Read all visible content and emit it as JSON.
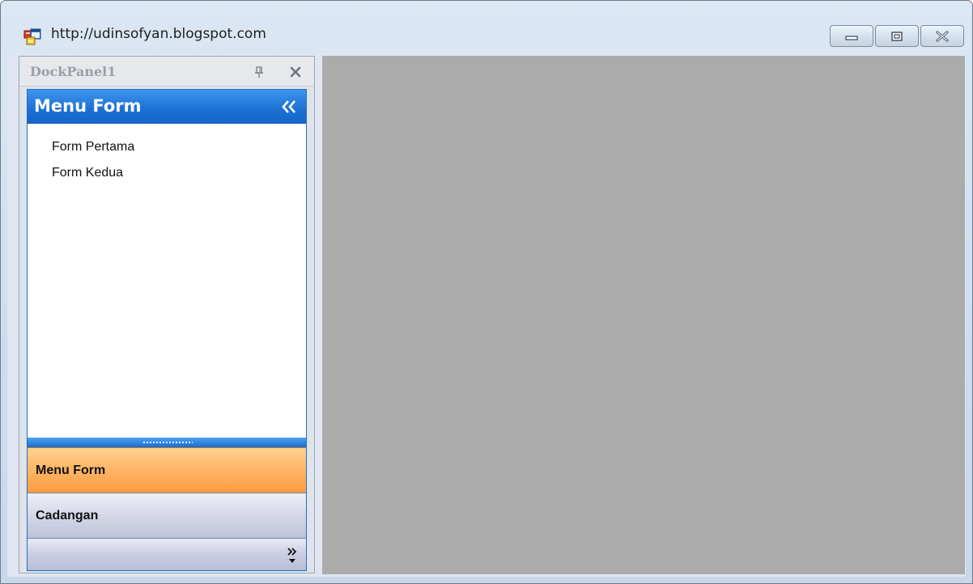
{
  "window": {
    "title": "http://udinsofyan.blogspot.com",
    "caption_buttons": [
      "minimize",
      "restore",
      "close"
    ]
  },
  "dock_panel": {
    "title": "DockPanel1",
    "pin_icon": "pin-icon",
    "close_icon": "close-icon"
  },
  "navbar": {
    "header_title": "Menu Form",
    "collapse_icon": "double-chevron-left-icon",
    "items": [
      {
        "label": "Form Pertama"
      },
      {
        "label": "Form Kedua"
      }
    ],
    "groups": [
      {
        "label": "Menu Form",
        "active": true
      },
      {
        "label": "Cadangan",
        "active": false
      }
    ],
    "overflow_icon": "double-chevron-right-dropdown-icon",
    "colors": {
      "header": "#1c6fd3",
      "active_group": "#ffb76a",
      "inactive_group": "#d7d9e9"
    }
  },
  "mdi_area": {
    "background": "#ababab"
  }
}
